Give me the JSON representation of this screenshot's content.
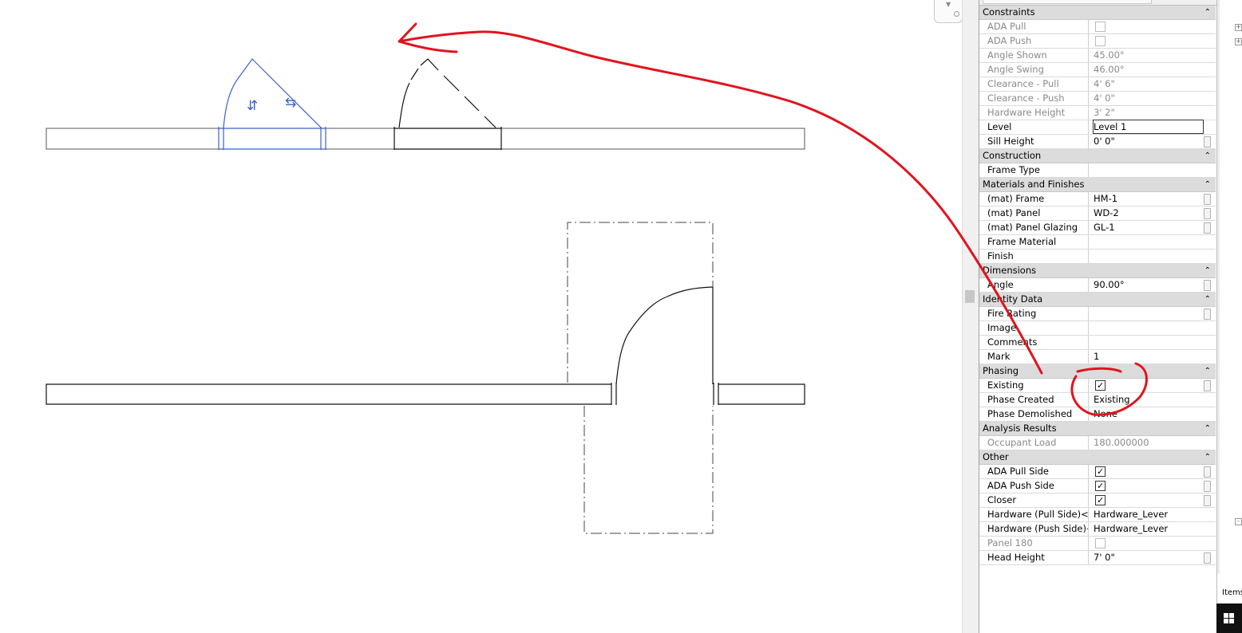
{
  "panel": {
    "groups": [
      {
        "key": "constraints",
        "label": "Constraints",
        "rows": [
          {
            "name": "ADA Pull",
            "type": "check",
            "checked": false,
            "dim": true
          },
          {
            "name": "ADA Push",
            "type": "check",
            "checked": false,
            "dim": true
          },
          {
            "name": "Angle Shown",
            "value": "45.00°",
            "dim": true
          },
          {
            "name": "Angle Swing",
            "value": "46.00°",
            "dim": true
          },
          {
            "name": "Clearance - Pull",
            "value": "4'  6\"",
            "dim": true
          },
          {
            "name": "Clearance - Push",
            "value": "4'  0\"",
            "dim": true
          },
          {
            "name": "Hardware Height",
            "value": "3'  2\"",
            "dim": true
          },
          {
            "name": "Level",
            "value": "Level 1",
            "selected": true
          },
          {
            "name": "Sill Height",
            "value": "0'  0\"",
            "editable": true
          }
        ]
      },
      {
        "key": "construction",
        "label": "Construction",
        "rows": [
          {
            "name": "Frame Type",
            "value": ""
          }
        ]
      },
      {
        "key": "materials",
        "label": "Materials and Finishes",
        "rows": [
          {
            "name": "(mat) Frame",
            "value": "HM-1",
            "editable": true
          },
          {
            "name": "(mat) Panel",
            "value": "WD-2",
            "editable": true
          },
          {
            "name": "(mat) Panel Glazing",
            "value": "GL-1",
            "editable": true
          },
          {
            "name": "Frame Material",
            "value": ""
          },
          {
            "name": "Finish",
            "value": ""
          }
        ]
      },
      {
        "key": "dimensions",
        "label": "Dimensions",
        "rows": [
          {
            "name": "Angle",
            "value": "90.00°",
            "editable": true
          }
        ]
      },
      {
        "key": "identity",
        "label": "Identity Data",
        "rows": [
          {
            "name": "Fire Rating",
            "value": "",
            "editable": true
          },
          {
            "name": "Image",
            "value": ""
          },
          {
            "name": "Comments",
            "value": ""
          },
          {
            "name": "Mark",
            "value": "1"
          }
        ]
      },
      {
        "key": "phasing",
        "label": "Phasing",
        "rows": [
          {
            "name": "Existing",
            "type": "check",
            "checked": true,
            "editable": true
          },
          {
            "name": "Phase Created",
            "value": "Existing"
          },
          {
            "name": "Phase Demolished",
            "value": "None"
          }
        ]
      },
      {
        "key": "analysis",
        "label": "Analysis Results",
        "rows": [
          {
            "name": "Occupant Load",
            "value": "180.000000",
            "dim": true
          }
        ]
      },
      {
        "key": "other",
        "label": "Other",
        "rows": [
          {
            "name": "ADA Pull Side",
            "type": "check",
            "checked": true,
            "editable": true
          },
          {
            "name": "ADA Push Side",
            "type": "check",
            "checked": true,
            "editable": true
          },
          {
            "name": "Closer",
            "type": "check",
            "checked": true,
            "editable": true
          },
          {
            "name": "Hardware (Pull Side)<E...",
            "value": "Hardware_Lever"
          },
          {
            "name": "Hardware (Push Side)<...",
            "value": "Hardware_Lever"
          },
          {
            "name": "Panel 180",
            "type": "check",
            "checked": false,
            "dim": true
          },
          {
            "name": "Head Height",
            "value": "7'  0\"",
            "editable": true
          }
        ]
      }
    ]
  },
  "right_strip": {
    "items_label": "Items"
  },
  "colors": {
    "selection_blue": "#3a5fcd",
    "annotation_red": "#e0141e",
    "group_bg": "#dcdcdc"
  },
  "icons": [
    "flip-vertical-icon",
    "flip-horizontal-icon",
    "collapse-chevron-icon",
    "windows-logo-icon"
  ]
}
